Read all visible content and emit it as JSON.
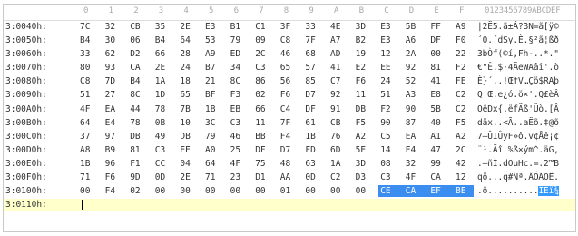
{
  "header": {
    "columns": [
      "0",
      "1",
      "2",
      "3",
      "4",
      "5",
      "6",
      "7",
      "8",
      "9",
      "A",
      "B",
      "C",
      "D",
      "E",
      "F"
    ],
    "ascii_header": "0123456789ABCDEF"
  },
  "rows": [
    {
      "addr": "3:0040h:",
      "bytes": [
        "7C",
        "32",
        "CB",
        "35",
        "2E",
        "E3",
        "B1",
        "C1",
        "3F",
        "33",
        "4E",
        "3D",
        "E3",
        "5B",
        "FF",
        "A9"
      ],
      "ascii": "|2Ë5.ã±Á?3N=ã[ÿ©"
    },
    {
      "addr": "3:0050h:",
      "bytes": [
        "B4",
        "30",
        "06",
        "B4",
        "64",
        "53",
        "79",
        "09",
        "C8",
        "7F",
        "A7",
        "B2",
        "E3",
        "A6",
        "DF",
        "F0"
      ],
      "ascii": "´0.´dSy.È.§²ã¦ßð"
    },
    {
      "addr": "3:0060h:",
      "bytes": [
        "33",
        "62",
        "D2",
        "66",
        "28",
        "A9",
        "ED",
        "2C",
        "46",
        "68",
        "AD",
        "19",
        "12",
        "2A",
        "00",
        "22"
      ],
      "ascii": "3bÒf(©í,Fh-..*.\""
    },
    {
      "addr": "3:0070h:",
      "bytes": [
        "80",
        "93",
        "CA",
        "2E",
        "24",
        "B7",
        "34",
        "C3",
        "65",
        "57",
        "41",
        "E2",
        "EE",
        "92",
        "81",
        "F2"
      ],
      "ascii": "€\"Ê.$·4ÃeWAâî'.ò"
    },
    {
      "addr": "3:0080h:",
      "bytes": [
        "C8",
        "7D",
        "B4",
        "1A",
        "18",
        "21",
        "8C",
        "86",
        "56",
        "85",
        "C7",
        "F6",
        "24",
        "52",
        "41",
        "FE"
      ],
      "ascii": "È}´..!Œ†V…Çö$RAþ"
    },
    {
      "addr": "3:0090h:",
      "bytes": [
        "51",
        "27",
        "8C",
        "1D",
        "65",
        "BF",
        "F3",
        "02",
        "F6",
        "D7",
        "92",
        "11",
        "51",
        "A3",
        "E8",
        "C2"
      ],
      "ascii": "Q'Œ.e¿ó.ö×'.Q£èÂ"
    },
    {
      "addr": "3:00A0h:",
      "bytes": [
        "4F",
        "EA",
        "44",
        "78",
        "7B",
        "1B",
        "EB",
        "66",
        "C4",
        "DF",
        "91",
        "DB",
        "F2",
        "90",
        "5B",
        "C2"
      ],
      "ascii": "OêDx{.ëfÄß'Ûò.[Â"
    },
    {
      "addr": "3:00B0h:",
      "bytes": [
        "64",
        "E4",
        "78",
        "0B",
        "10",
        "3C",
        "C3",
        "11",
        "7F",
        "61",
        "CB",
        "F5",
        "90",
        "87",
        "40",
        "F5"
      ],
      "ascii": "däx..<Ã..aËõ.‡@õ"
    },
    {
      "addr": "3:00C0h:",
      "bytes": [
        "37",
        "97",
        "DB",
        "49",
        "DB",
        "79",
        "46",
        "BB",
        "F4",
        "1B",
        "76",
        "A2",
        "C5",
        "EA",
        "A1",
        "A2"
      ],
      "ascii": "7—ÛIÛyF»ô.v¢Åê¡¢"
    },
    {
      "addr": "3:00D0h:",
      "bytes": [
        "A8",
        "B9",
        "81",
        "C3",
        "EE",
        "A0",
        "25",
        "DF",
        "D7",
        "FD",
        "6D",
        "5E",
        "14",
        "E4",
        "47",
        "2C"
      ],
      "ascii": "¨¹.Ãî %ß×ým^.äG,"
    },
    {
      "addr": "3:00E0h:",
      "bytes": [
        "1B",
        "96",
        "F1",
        "CC",
        "04",
        "64",
        "4F",
        "75",
        "48",
        "63",
        "1A",
        "3D",
        "08",
        "32",
        "99",
        "42"
      ],
      "ascii": ".–ñÌ.dOuHc.=.2™B"
    },
    {
      "addr": "3:00F0h:",
      "bytes": [
        "71",
        "F6",
        "9D",
        "0D",
        "2E",
        "71",
        "23",
        "D1",
        "AA",
        "0D",
        "C2",
        "D3",
        "C3",
        "4F",
        "CA",
        "12"
      ],
      "ascii": "qö...q#Ñª.ÂÓÃOÊ."
    },
    {
      "addr": "3:0100h:",
      "bytes": [
        "00",
        "F4",
        "02",
        "00",
        "00",
        "00",
        "00",
        "00",
        "01",
        "00",
        "00",
        "00",
        "CE",
        "CA",
        "EF",
        "BE"
      ],
      "ascii": ".ô..........ÎÊï¾"
    },
    {
      "addr": "3:0110h:",
      "bytes": [],
      "ascii": ""
    }
  ],
  "selection": {
    "row": 12,
    "from_col": 12,
    "to_col": 15
  }
}
